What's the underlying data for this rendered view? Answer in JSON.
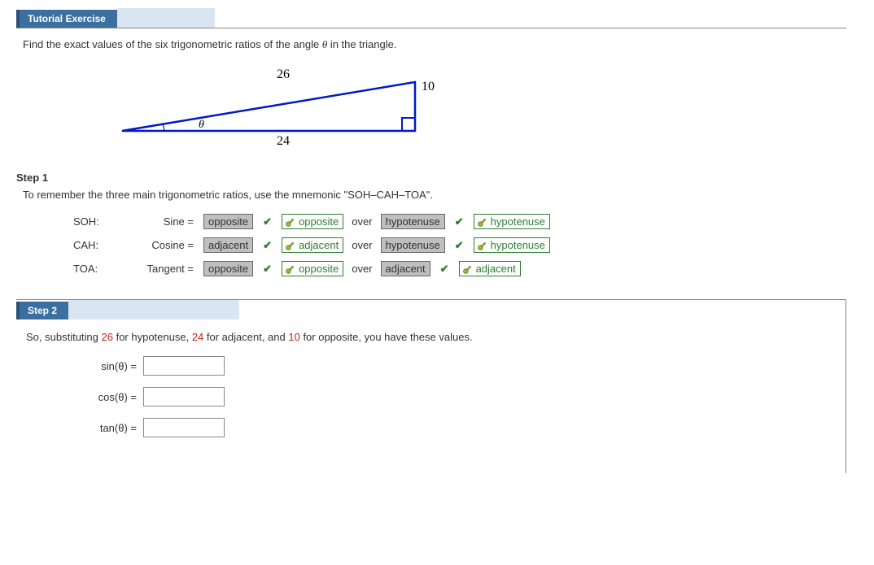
{
  "header": {
    "title": "Tutorial Exercise"
  },
  "prompt": {
    "before": "Find the exact values of the six trigonometric ratios of the angle ",
    "theta": "θ",
    "after": " in the triangle."
  },
  "triangle": {
    "hypotenuse": "26",
    "adjacent": "24",
    "opposite": "10",
    "angle_label": "θ"
  },
  "step1": {
    "title": "Step 1",
    "desc": "To remember the three main trigonometric ratios, use the mnemonic \"SOH–CAH–TOA\".",
    "rows": [
      {
        "label": "SOH:",
        "eq": "Sine =",
        "ans": "opposite",
        "key1": "opposite",
        "over": "over",
        "ans2": "hypotenuse",
        "key2": "hypotenuse"
      },
      {
        "label": "CAH:",
        "eq": "Cosine =",
        "ans": "adjacent",
        "key1": "adjacent",
        "over": "over",
        "ans2": "hypotenuse",
        "key2": "hypotenuse"
      },
      {
        "label": "TOA:",
        "eq": "Tangent =",
        "ans": "opposite",
        "key1": "opposite",
        "over": "over",
        "ans2": "adjacent",
        "key2": "adjacent"
      }
    ]
  },
  "step2": {
    "title": "Step 2",
    "text_parts": {
      "p1": "So, substituting ",
      "v1": "26",
      "p2": " for hypotenuse, ",
      "v2": "24",
      "p3": " for adjacent, and ",
      "v3": "10",
      "p4": " for opposite, you have these values."
    },
    "rows": [
      {
        "label": "sin(θ)  ="
      },
      {
        "label": "cos(θ)  ="
      },
      {
        "label": "tan(θ)  ="
      }
    ]
  },
  "chart_data": {
    "type": "table",
    "title": "Right triangle side lengths",
    "x": [
      "hypotenuse",
      "adjacent",
      "opposite"
    ],
    "values": [
      26,
      24,
      10
    ]
  }
}
